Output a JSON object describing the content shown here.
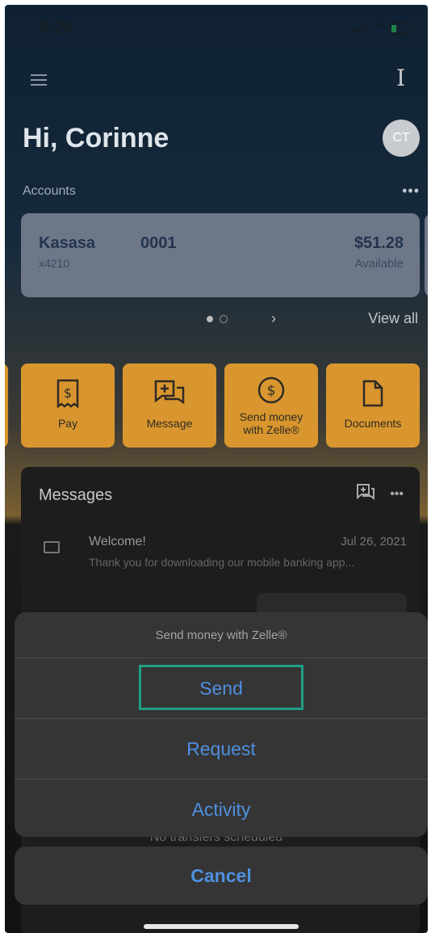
{
  "status": {
    "time": "8:24"
  },
  "header": {
    "greeting": "Hi, Corinne",
    "avatar_initials": "CT"
  },
  "accounts": {
    "label": "Accounts",
    "more": "•••",
    "card": {
      "name": "Kasasa",
      "number": "0001",
      "mask": "x4210",
      "balance": "$51.28",
      "balance_label": "Available"
    },
    "view_all": "View all",
    "next_arrow": "›",
    "page_index": 1,
    "page_count": 2
  },
  "quick_actions": [
    {
      "label": "Pay",
      "icon": "receipt-dollar-icon"
    },
    {
      "label": "Message",
      "icon": "message-add-icon"
    },
    {
      "label": "Send money with Zelle®",
      "icon": "dollar-circle-icon"
    },
    {
      "label": "Documents",
      "icon": "document-icon"
    }
  ],
  "messages": {
    "title": "Messages",
    "more": "•••",
    "items": [
      {
        "subject": "Welcome!",
        "date": "Jul 26, 2021",
        "preview": "Thank you for downloading our mobile banking app..."
      }
    ]
  },
  "transfers": {
    "empty_text": "No transfers scheduled"
  },
  "action_sheet": {
    "title": "Send money with Zelle®",
    "options": [
      "Send",
      "Request",
      "Activity"
    ],
    "cancel": "Cancel",
    "highlight_color": "#1f9f85"
  },
  "colors": {
    "tile": "#d9962e",
    "action_blue": "#4f8fe0"
  }
}
